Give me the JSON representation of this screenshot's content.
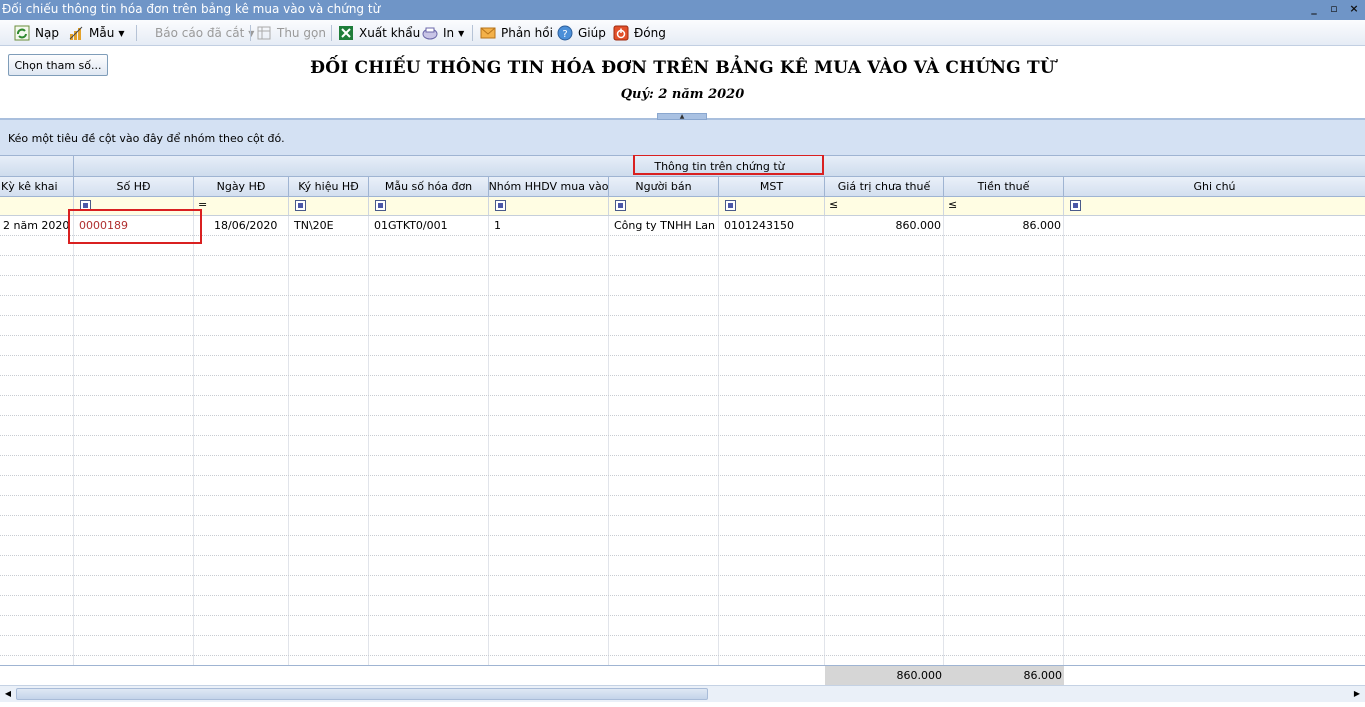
{
  "window": {
    "title": "Đối chiếu thông tin hóa đơn trên bảng kê mua vào và chứng từ",
    "minimize": "_",
    "restore": "▫",
    "close": "×"
  },
  "toolbar": {
    "refresh": "Nạp",
    "template": "Mẫu",
    "cut_report": "Báo cáo đã cắt",
    "collapse": "Thu gọn",
    "export": "Xuất khẩu",
    "print": "In",
    "feedback": "Phản hồi",
    "help": "Giúp",
    "close": "Đóng"
  },
  "options_button": "Chọn tham số...",
  "report": {
    "title": "ĐỐI CHIẾU THÔNG TIN HÓA ĐƠN TRÊN BẢNG KÊ MUA VÀO VÀ CHỨNG TỪ",
    "subtitle": "Quý: 2 năm 2020"
  },
  "group_panel_text": "Kéo một tiêu đề cột vào đây để nhóm theo cột đó.",
  "grid": {
    "band_label": "Thông tin trên chứng từ",
    "columns": [
      "Kỳ kê khai",
      "Số HĐ",
      "Ngày HĐ",
      "Ký hiệu HĐ",
      "Mẫu số hóa đơn",
      "Nhóm HHDV mua vào",
      "Người bán",
      "MST",
      "Giá trị chưa thuế",
      "Tiền thuế",
      "Ghi chú"
    ],
    "filter_ops": {
      "ngay_hd": "=",
      "gia_tri": "≤",
      "tien_thue": "≤"
    },
    "rows": [
      {
        "ky_ke_khai": "2 năm 2020",
        "so_hd": "0000189",
        "ngay_hd": "18/06/2020",
        "ky_hieu_hd": "TN\\20E",
        "mau_so": "01GTKT0/001",
        "nhom_hhdv": "1",
        "nguoi_ban": "Công ty TNHH Lan",
        "mst": "0101243150",
        "gia_tri": "860.000",
        "tien_thue": "86.000",
        "ghi_chu": ""
      }
    ],
    "totals": {
      "gia_tri": "860.000",
      "tien_thue": "86.000"
    }
  },
  "colors": {
    "titlebar": "#6f95c7",
    "highlight": "#d92020",
    "group_panel": "#d4e1f3",
    "filter_row": "#fffde3"
  }
}
